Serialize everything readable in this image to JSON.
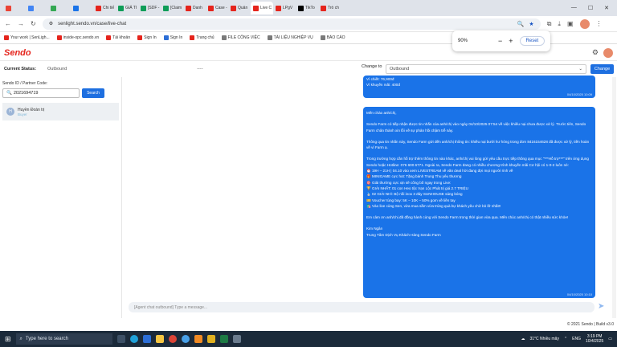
{
  "browser": {
    "tabs": [
      {
        "label": "",
        "color": "#ea4335"
      },
      {
        "label": "",
        "color": "#4285f4"
      },
      {
        "label": "",
        "color": "#34a853"
      },
      {
        "label": "",
        "color": "#1a73e8"
      },
      {
        "label": "Chi tiế",
        "color": "#e5241c"
      },
      {
        "label": "GIÁ TI",
        "color": "#0f9d58"
      },
      {
        "label": "[SDF -",
        "color": "#0f9d58"
      },
      {
        "label": "[Claim",
        "color": "#0f9d58"
      },
      {
        "label": "Danh",
        "color": "#e5241c"
      },
      {
        "label": "Case -",
        "color": "#e5241c"
      },
      {
        "label": "Quản",
        "color": "#e5241c"
      },
      {
        "label": "Live C",
        "color": "#e5241c"
      },
      {
        "label": "LPgV",
        "color": "#e5241c"
      },
      {
        "label": "TikTo",
        "color": "#000000"
      },
      {
        "label": "Trò ch",
        "color": "#e5241c"
      }
    ],
    "url": "senlight.sendo.vn/case/live-chat",
    "bookmarks": [
      "Your work | SenLigh...",
      "inside-opc.sendo.vn",
      "Tài khoản",
      "Sign In",
      "Sign In",
      "Trang chủ",
      "FILE CÔNG VIỆC",
      "TÀI LIỆU NGHIỆP VỤ",
      "BÁO CÁO"
    ],
    "zoom": {
      "level": "90%",
      "minus": "−",
      "plus": "+",
      "reset": "Reset"
    }
  },
  "app": {
    "logo": "Sendo",
    "current_status_label": "Current Status:",
    "current_status_value": "Outbound",
    "dashes": "----",
    "change_to_label": "Change to",
    "change_to_value": "Outbound",
    "change_button": "Change",
    "sid_label": "Sendo ID / Partner Code:",
    "search_value": "2021694719",
    "search_button": "Search",
    "agent_initial": "H",
    "agent_name": "Huyền Đoàn trị",
    "agent_sub": "Buyer",
    "compose_placeholder": "[Agent chat outbound] Type a message...",
    "footer": "© 2021 Sendo | Build v3.0"
  },
  "messages": {
    "m1": {
      "line1": "Vì chiết: 76,900đ",
      "line2": "Vì khuyến mãi: 400đ",
      "time": "04/10/2025 10:09"
    },
    "m2": {
      "p1": "Mến chào anh/chị,",
      "p2": "Sendo Farm có tiếp nhận được tin nhắn của anh/chị vào ngày 04/10/2025 07:54 về việc khiếu nại chưa được xử lý. Trước tiên, Sendo Farm chân thành xin lỗi về sự phản hồi chậm trễ này.",
      "p3": "Thông qua tin nhắn này, Sendo Farm gửi đến anh/chị thông tin: khiếu nại bưởi hư hỏng trong đơn 8416154628 đã được xử lý, tiền hoàn về ví Farm ạ.",
      "p4a": "Trong trường hợp cần hỗ trợ thêm thông tin nào khác, anh/chị vui lòng gửi yêu cầu trực tiếp thông qua mục \"***Hỗ trợ***\" trên ứng dụng Sendo hoặc Hotline: 076 600 6771. Ngoài ra, Sendo Farm đang có nhiều chương trình khuyến mãi Cơ hội có 1-0-2 luôn nè:",
      "l1": "⏰ 19H – 21H | 04.10 vào xem LIVESTREAM về văn deal hời đang đợi mọi người rinh về",
      "l2": "🎁 MINIGAME cực hot: Tặng bánh Trung Thu yêu thương",
      "l3": "🎯 Giải thưởng cực xịn sẽ cổng bố ngay trong Live:",
      "l4": "🏆 GIẢI NHẤT: 01 con Heo tộc Vạn Lộc Phát trị giá 2.7 TRIỆU",
      "l5": "🥈 02 GIẢI NHÌ: Bộ nồi inox 3 đáy SUNHOUSE sáng bóng",
      "l6": "🎫 Voucher tùng bay: 5K – 10K – 50% gom về liền tay",
      "l7": "🛍️ Vào live cùng Sen, vừa mua sắm vừa trúng quà bự khách yêu chờ bỏ lỡ nhất!!",
      "p5": "Em cảm ơn anh/chị đã đồng hành cùng với Sendo Farm trong thời gian vừa qua. Mến chúc anh/chị có thật nhiều sức khỏe!",
      "sig1": "Kim Ngân",
      "sig2": "Trung Tâm Dịch Vụ Khách Hàng Sendo Farm",
      "time": "04/10/2025 10:10"
    }
  },
  "taskbar": {
    "search": "Type here to search",
    "weather": "31°C Nhiều mây",
    "lang": "ENG",
    "time": "3:19 PM",
    "date": "10/4/2025"
  }
}
